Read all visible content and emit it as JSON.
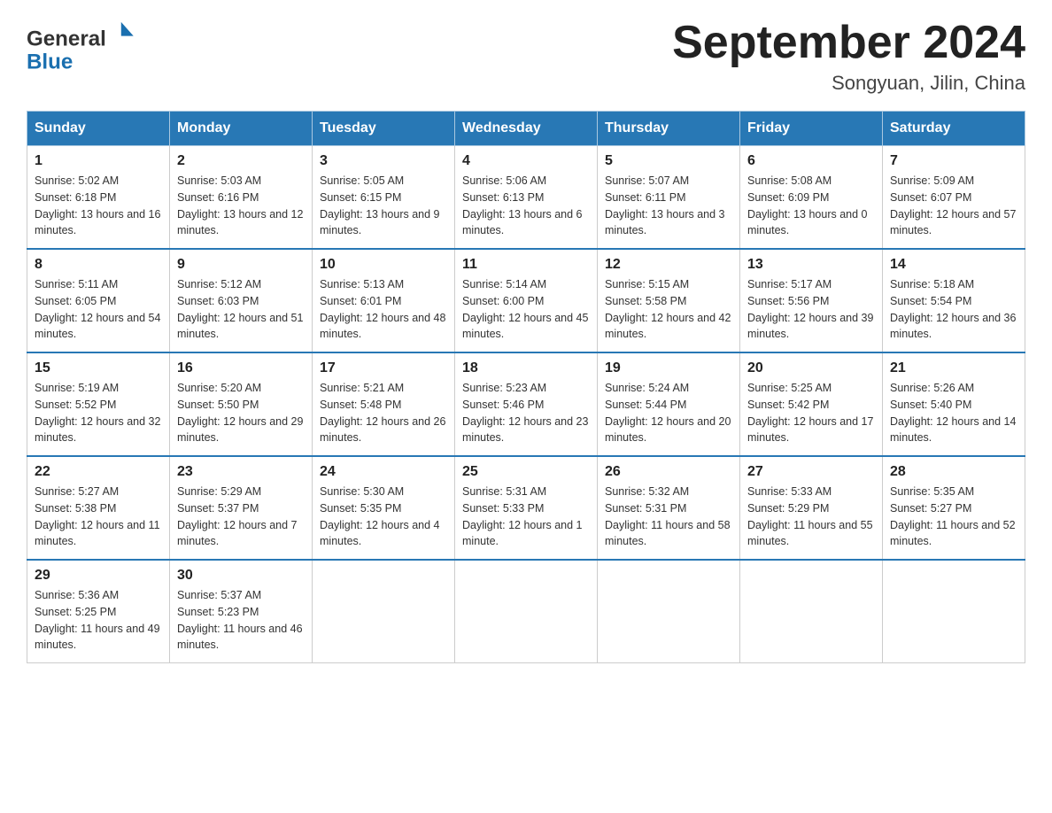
{
  "header": {
    "title": "September 2024",
    "subtitle": "Songyuan, Jilin, China",
    "logo_general": "General",
    "logo_blue": "Blue"
  },
  "calendar": {
    "days_of_week": [
      "Sunday",
      "Monday",
      "Tuesday",
      "Wednesday",
      "Thursday",
      "Friday",
      "Saturday"
    ],
    "weeks": [
      [
        {
          "day": "1",
          "sunrise": "5:02 AM",
          "sunset": "6:18 PM",
          "daylight": "13 hours and 16 minutes."
        },
        {
          "day": "2",
          "sunrise": "5:03 AM",
          "sunset": "6:16 PM",
          "daylight": "13 hours and 12 minutes."
        },
        {
          "day": "3",
          "sunrise": "5:05 AM",
          "sunset": "6:15 PM",
          "daylight": "13 hours and 9 minutes."
        },
        {
          "day": "4",
          "sunrise": "5:06 AM",
          "sunset": "6:13 PM",
          "daylight": "13 hours and 6 minutes."
        },
        {
          "day": "5",
          "sunrise": "5:07 AM",
          "sunset": "6:11 PM",
          "daylight": "13 hours and 3 minutes."
        },
        {
          "day": "6",
          "sunrise": "5:08 AM",
          "sunset": "6:09 PM",
          "daylight": "13 hours and 0 minutes."
        },
        {
          "day": "7",
          "sunrise": "5:09 AM",
          "sunset": "6:07 PM",
          "daylight": "12 hours and 57 minutes."
        }
      ],
      [
        {
          "day": "8",
          "sunrise": "5:11 AM",
          "sunset": "6:05 PM",
          "daylight": "12 hours and 54 minutes."
        },
        {
          "day": "9",
          "sunrise": "5:12 AM",
          "sunset": "6:03 PM",
          "daylight": "12 hours and 51 minutes."
        },
        {
          "day": "10",
          "sunrise": "5:13 AM",
          "sunset": "6:01 PM",
          "daylight": "12 hours and 48 minutes."
        },
        {
          "day": "11",
          "sunrise": "5:14 AM",
          "sunset": "6:00 PM",
          "daylight": "12 hours and 45 minutes."
        },
        {
          "day": "12",
          "sunrise": "5:15 AM",
          "sunset": "5:58 PM",
          "daylight": "12 hours and 42 minutes."
        },
        {
          "day": "13",
          "sunrise": "5:17 AM",
          "sunset": "5:56 PM",
          "daylight": "12 hours and 39 minutes."
        },
        {
          "day": "14",
          "sunrise": "5:18 AM",
          "sunset": "5:54 PM",
          "daylight": "12 hours and 36 minutes."
        }
      ],
      [
        {
          "day": "15",
          "sunrise": "5:19 AM",
          "sunset": "5:52 PM",
          "daylight": "12 hours and 32 minutes."
        },
        {
          "day": "16",
          "sunrise": "5:20 AM",
          "sunset": "5:50 PM",
          "daylight": "12 hours and 29 minutes."
        },
        {
          "day": "17",
          "sunrise": "5:21 AM",
          "sunset": "5:48 PM",
          "daylight": "12 hours and 26 minutes."
        },
        {
          "day": "18",
          "sunrise": "5:23 AM",
          "sunset": "5:46 PM",
          "daylight": "12 hours and 23 minutes."
        },
        {
          "day": "19",
          "sunrise": "5:24 AM",
          "sunset": "5:44 PM",
          "daylight": "12 hours and 20 minutes."
        },
        {
          "day": "20",
          "sunrise": "5:25 AM",
          "sunset": "5:42 PM",
          "daylight": "12 hours and 17 minutes."
        },
        {
          "day": "21",
          "sunrise": "5:26 AM",
          "sunset": "5:40 PM",
          "daylight": "12 hours and 14 minutes."
        }
      ],
      [
        {
          "day": "22",
          "sunrise": "5:27 AM",
          "sunset": "5:38 PM",
          "daylight": "12 hours and 11 minutes."
        },
        {
          "day": "23",
          "sunrise": "5:29 AM",
          "sunset": "5:37 PM",
          "daylight": "12 hours and 7 minutes."
        },
        {
          "day": "24",
          "sunrise": "5:30 AM",
          "sunset": "5:35 PM",
          "daylight": "12 hours and 4 minutes."
        },
        {
          "day": "25",
          "sunrise": "5:31 AM",
          "sunset": "5:33 PM",
          "daylight": "12 hours and 1 minute."
        },
        {
          "day": "26",
          "sunrise": "5:32 AM",
          "sunset": "5:31 PM",
          "daylight": "11 hours and 58 minutes."
        },
        {
          "day": "27",
          "sunrise": "5:33 AM",
          "sunset": "5:29 PM",
          "daylight": "11 hours and 55 minutes."
        },
        {
          "day": "28",
          "sunrise": "5:35 AM",
          "sunset": "5:27 PM",
          "daylight": "11 hours and 52 minutes."
        }
      ],
      [
        {
          "day": "29",
          "sunrise": "5:36 AM",
          "sunset": "5:25 PM",
          "daylight": "11 hours and 49 minutes."
        },
        {
          "day": "30",
          "sunrise": "5:37 AM",
          "sunset": "5:23 PM",
          "daylight": "11 hours and 46 minutes."
        },
        null,
        null,
        null,
        null,
        null
      ]
    ]
  }
}
